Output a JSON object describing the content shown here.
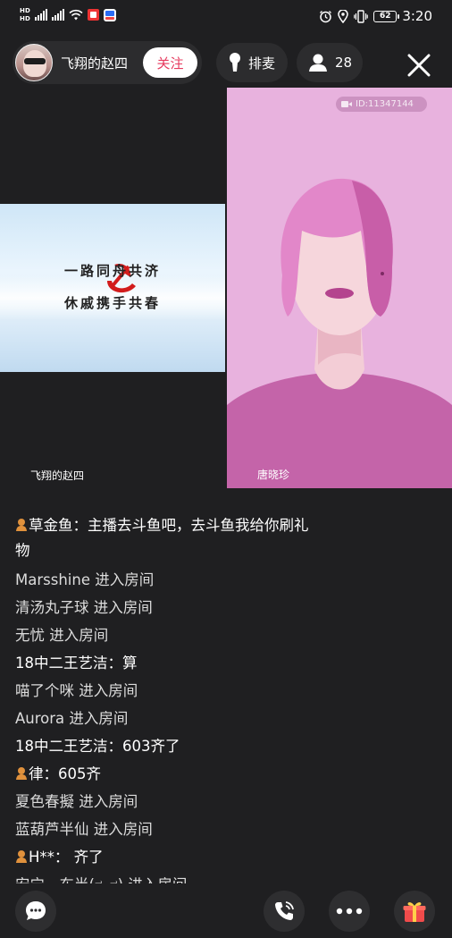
{
  "status_bar": {
    "hd_top": "HD",
    "hd_bottom": "HD",
    "network": "4G",
    "battery": "62",
    "time": "3:20"
  },
  "header": {
    "host_name": "飞翔的赵四",
    "follow_label": "关注",
    "queue_label": "排麦",
    "viewer_count": "28"
  },
  "videos": {
    "left": {
      "name_label": "飞翔的赵四",
      "slogan_line1": "一路同舟共济",
      "slogan_line2": "休戚携手共春"
    },
    "right": {
      "name_label": "唐晓珍",
      "id_tag": "ID:11347144"
    }
  },
  "chat": {
    "messages": [
      {
        "badge": true,
        "who": "草金鱼：",
        "text": "主播去斗鱼吧，去斗鱼我给你刷礼物"
      },
      {
        "badge": false,
        "who": "Marsshine",
        "text": " 进入房间"
      },
      {
        "badge": false,
        "who": "清汤丸子球",
        "text": " 进入房间"
      },
      {
        "badge": false,
        "who": "无忧",
        "text": " 进入房间"
      },
      {
        "badge": false,
        "who": "18中二王艺洁：",
        "text": "算"
      },
      {
        "badge": false,
        "who": "喵了个咪",
        "text": " 进入房间"
      },
      {
        "badge": false,
        "who": "Aurora",
        "text": " 进入房间"
      },
      {
        "badge": false,
        "who": "18中二王艺洁：",
        "text": "603齐了"
      },
      {
        "badge": true,
        "who": "律：",
        "text": "605齐"
      },
      {
        "badge": false,
        "who": "夏色春擬",
        "text": " 进入房间"
      },
      {
        "badge": false,
        "who": "蓝葫芦半仙",
        "text": " 进入房间"
      },
      {
        "badge": true,
        "who": "H**：",
        "text": " 齐了"
      },
      {
        "badge": false,
        "who": "安宁一东半(ಠ_ಠ)",
        "text": " 进入房间"
      }
    ]
  },
  "bottom_bar": {
    "icons": [
      "chat-bubble-icon",
      "phone-call-icon",
      "more-dots-icon",
      "gift-icon"
    ]
  },
  "colors": {
    "background": "#1f1f21",
    "pill": "#2c2c2e",
    "follow_text": "#e63a5e",
    "right_video_bg": "#e8b2de",
    "badge": "#e0913c"
  }
}
